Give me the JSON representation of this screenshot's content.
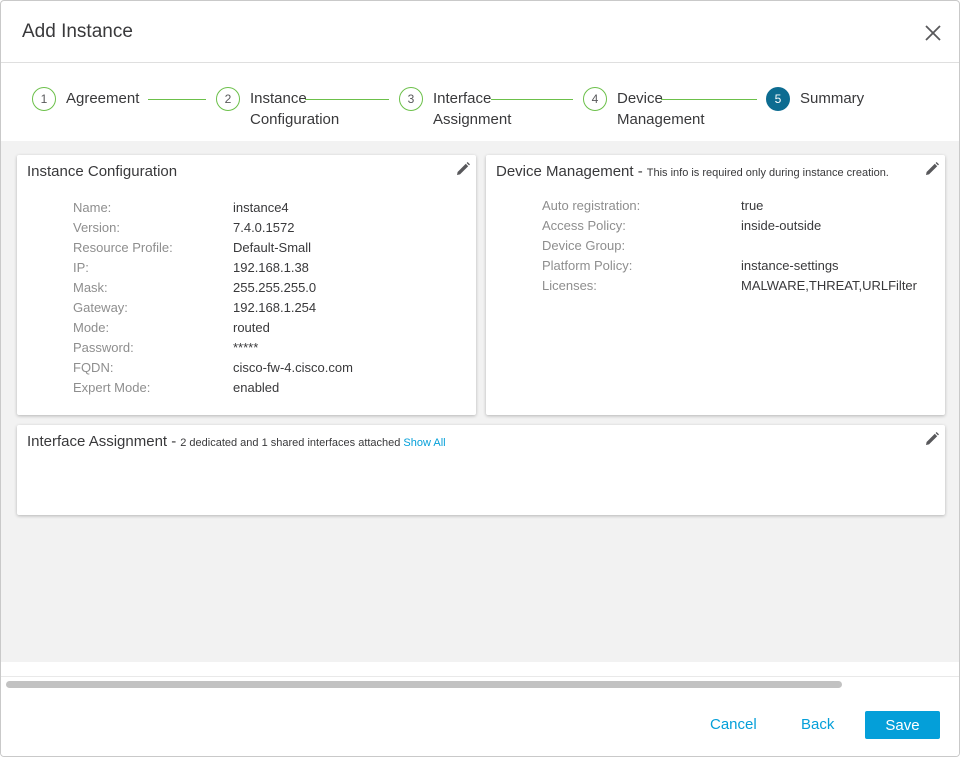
{
  "dialog": {
    "title": "Add Instance"
  },
  "wizard": {
    "steps": [
      {
        "number": "1",
        "label_line1": "Agreement",
        "label_line2": ""
      },
      {
        "number": "2",
        "label_line1": "Instance",
        "label_line2": "Configuration"
      },
      {
        "number": "3",
        "label_line1": "Interface",
        "label_line2": "Assignment"
      },
      {
        "number": "4",
        "label_line1": "Device",
        "label_line2": "Management"
      },
      {
        "number": "5",
        "label_line1": "Summary",
        "label_line2": ""
      }
    ],
    "active_step": 5
  },
  "instance_config": {
    "title": "Instance Configuration",
    "rows": [
      {
        "key": "Name:",
        "value": "instance4"
      },
      {
        "key": "Version:",
        "value": "7.4.0.1572"
      },
      {
        "key": "Resource Profile:",
        "value": "Default-Small"
      },
      {
        "key": "IP:",
        "value": "192.168.1.38"
      },
      {
        "key": "Mask:",
        "value": "255.255.255.0"
      },
      {
        "key": "Gateway:",
        "value": "192.168.1.254"
      },
      {
        "key": "Mode:",
        "value": "routed"
      },
      {
        "key": "Password:",
        "value": "*****"
      },
      {
        "key": "FQDN:",
        "value": "cisco-fw-4.cisco.com"
      },
      {
        "key": "Expert Mode:",
        "value": "enabled"
      }
    ]
  },
  "device_management": {
    "title": "Device Management -",
    "subtitle": "This info is required only during instance creation.",
    "rows": [
      {
        "key": "Auto registration:",
        "value": "true"
      },
      {
        "key": "Access Policy:",
        "value": "inside-outside"
      },
      {
        "key": "Device Group:",
        "value": ""
      },
      {
        "key": "Platform Policy:",
        "value": "instance-settings"
      },
      {
        "key": "Licenses:",
        "value": "MALWARE,THREAT,URLFilter"
      }
    ]
  },
  "interface_assignment": {
    "title": "Interface Assignment -",
    "subtitle": "2 dedicated and 1 shared interfaces attached",
    "link": "Show All"
  },
  "footer": {
    "cancel_label": "Cancel",
    "back_label": "Back",
    "save_label": "Save"
  },
  "colors": {
    "accent": "#049fd9",
    "active_step": "#0d6c91",
    "complete_step": "#6cc04a"
  }
}
